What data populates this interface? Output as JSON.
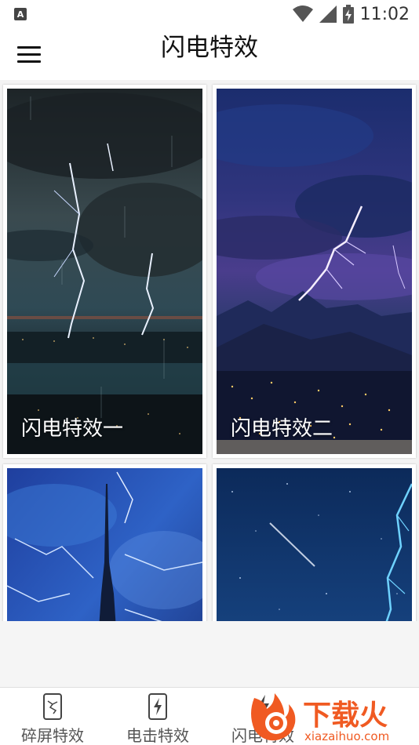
{
  "status_bar": {
    "app_icon_letter": "A",
    "time": "11:02"
  },
  "app_bar": {
    "title": "闪电特效"
  },
  "cards": [
    {
      "label": "闪电特效一"
    },
    {
      "label": "闪电特效二"
    },
    {
      "label": ""
    },
    {
      "label": ""
    }
  ],
  "bottom_nav": {
    "items": [
      {
        "label": "碎屏特效",
        "icon": "broken-phone-icon"
      },
      {
        "label": "电击特效",
        "icon": "electric-phone-icon"
      },
      {
        "label": "闪电特效",
        "icon": "lightning-icon"
      }
    ]
  },
  "watermark": {
    "brand": "下载火",
    "url": "xiazaihuo.com"
  },
  "colors": {
    "background": "#f5f5f5",
    "bar": "#ffffff",
    "title_text": "#111111",
    "nav_text": "#555555",
    "watermark_orange": "#f05a22"
  }
}
